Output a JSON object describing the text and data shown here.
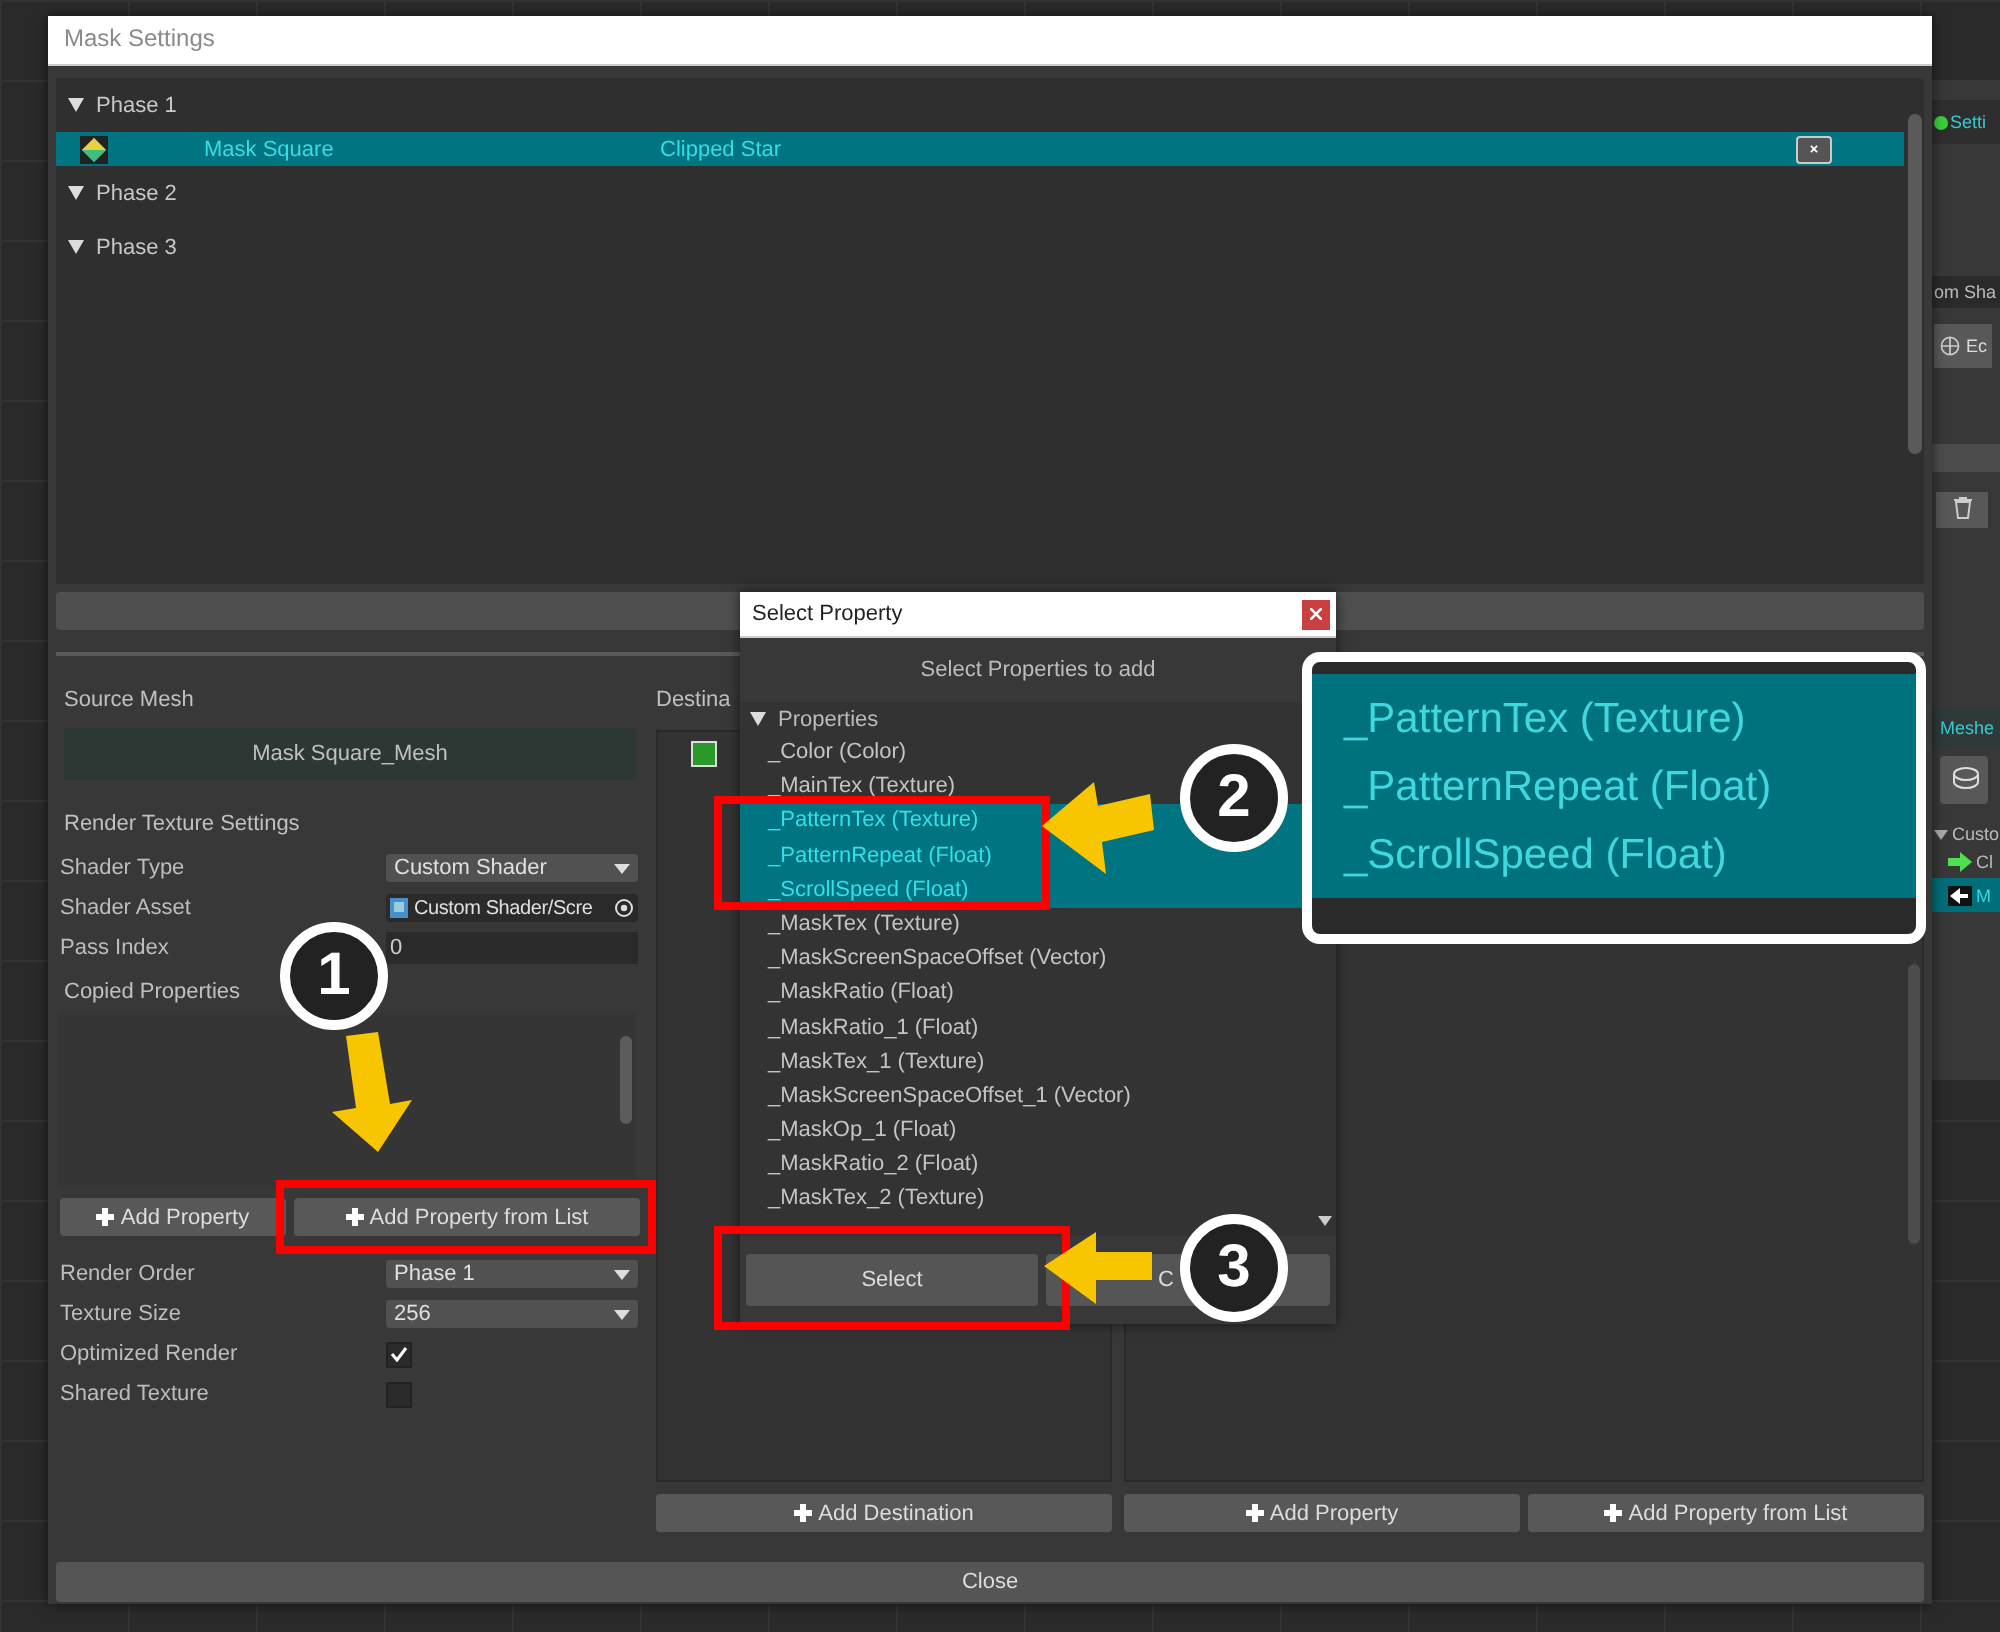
{
  "editor_side_panel": {
    "tab_label": "Setti",
    "field_text": "om Sha",
    "edit_button": "Ec",
    "section_title": "Meshe",
    "tree": [
      {
        "label": "Custo",
        "expanded": true,
        "children": [
          {
            "label": "Cl",
            "selected": false
          },
          {
            "label": "M",
            "selected": true
          }
        ]
      }
    ]
  },
  "mask_settings": {
    "title": "Mask Settings",
    "phases": [
      {
        "label": "Phase 1",
        "expanded": true,
        "rows": [
          {
            "name": "Mask Square",
            "target": "Clipped Star",
            "selected": true
          }
        ]
      },
      {
        "label": "Phase 2",
        "expanded": true
      },
      {
        "label": "Phase 3",
        "expanded": true
      }
    ],
    "source": {
      "heading": "Source Mesh",
      "mesh": "Mask Square_Mesh",
      "section": "Render Texture Settings",
      "fields": [
        {
          "kind": "dropdown",
          "label": "Shader Type",
          "value": "Custom Shader"
        },
        {
          "kind": "object",
          "label": "Shader Asset",
          "value": "Custom Shader/Scre"
        },
        {
          "kind": "input",
          "label": "Pass Index",
          "value": "0"
        }
      ],
      "copied_heading": "Copied Properties",
      "buttons": [
        "Add Property",
        "Add Property from List"
      ],
      "settings": [
        {
          "kind": "dropdown",
          "label": "Render Order",
          "value": "Phase 1"
        },
        {
          "kind": "dropdown",
          "label": "Texture Size",
          "value": "256"
        },
        {
          "kind": "checkbox",
          "label": "Optimized Render",
          "checked": true
        },
        {
          "kind": "checkbox",
          "label": "Shared Texture",
          "checked": false
        }
      ]
    },
    "destinations": {
      "heading": "Destina",
      "button": "Add Destination"
    },
    "properties_buttons": [
      "Add Property",
      "Add Property from List"
    ],
    "close_button": "Close"
  },
  "select_property": {
    "title": "Select Property",
    "heading": "Select Properties to add",
    "group": {
      "label": "Properties",
      "expanded": true
    },
    "items": [
      {
        "label": "_Color (Color)",
        "selected": false
      },
      {
        "label": "_MainTex (Texture)",
        "selected": false
      },
      {
        "label": "_PatternTex (Texture)",
        "selected": true
      },
      {
        "label": "_PatternRepeat (Float)",
        "selected": true
      },
      {
        "label": "_ScrollSpeed (Float)",
        "selected": true
      },
      {
        "label": "_MaskTex (Texture)",
        "selected": false
      },
      {
        "label": "_MaskScreenSpaceOffset (Vector)",
        "selected": false
      },
      {
        "label": "_MaskRatio (Float)",
        "selected": false
      },
      {
        "label": "_MaskRatio_1 (Float)",
        "selected": false
      },
      {
        "label": "_MaskTex_1 (Texture)",
        "selected": false
      },
      {
        "label": "_MaskScreenSpaceOffset_1 (Vector)",
        "selected": false
      },
      {
        "label": "_MaskOp_1 (Float)",
        "selected": false
      },
      {
        "label": "_MaskRatio_2 (Float)",
        "selected": false
      },
      {
        "label": "_MaskTex_2 (Texture)",
        "selected": false
      }
    ],
    "buttons": [
      "Select",
      "C"
    ]
  },
  "annotations": {
    "steps": [
      "1",
      "2",
      "3"
    ],
    "callout": [
      "_PatternTex (Texture)",
      "_PatternRepeat (Float)",
      "_ScrollSpeed (Float)"
    ]
  }
}
